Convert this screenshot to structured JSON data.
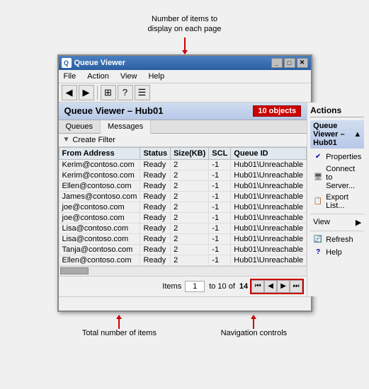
{
  "annotation": {
    "top_text": "Number of items to\ndisplay on each page",
    "bottom_total": "Total number of items",
    "bottom_nav": "Navigation controls"
  },
  "window": {
    "title": "Queue Viewer",
    "icon": "Q"
  },
  "menu": {
    "items": [
      "File",
      "Action",
      "View",
      "Help"
    ]
  },
  "toolbar": {
    "buttons": [
      "◀",
      "▶",
      "⊞",
      "?",
      "☰"
    ]
  },
  "panel_header": {
    "title": "Queue Viewer – Hub01",
    "badge": "10 objects"
  },
  "tabs": {
    "items": [
      "Queues",
      "Messages"
    ],
    "active": "Messages"
  },
  "filter": {
    "label": "Create Filter"
  },
  "table": {
    "columns": [
      "From Address",
      "Status",
      "Size(KB)",
      "SCL",
      "Queue ID"
    ],
    "rows": [
      [
        "Kerim@contoso.com",
        "Ready",
        "2",
        "-1",
        "Hub01\\Unreachable"
      ],
      [
        "Kerim@contoso.com",
        "Ready",
        "2",
        "-1",
        "Hub01\\Unreachable"
      ],
      [
        "Ellen@contoso.com",
        "Ready",
        "2",
        "-1",
        "Hub01\\Unreachable"
      ],
      [
        "James@contoso.com",
        "Ready",
        "2",
        "-1",
        "Hub01\\Unreachable"
      ],
      [
        "joe@contoso.com",
        "Ready",
        "2",
        "-1",
        "Hub01\\Unreachable"
      ],
      [
        "joe@contoso.com",
        "Ready",
        "2",
        "-1",
        "Hub01\\Unreachable"
      ],
      [
        "Lisa@contoso.com",
        "Ready",
        "2",
        "-1",
        "Hub01\\Unreachable"
      ],
      [
        "Lisa@contoso.com",
        "Ready",
        "2",
        "-1",
        "Hub01\\Unreachable"
      ],
      [
        "Tanja@contoso.com",
        "Ready",
        "2",
        "-1",
        "Hub01\\Unreachable"
      ],
      [
        "Ellen@contoso.com",
        "Ready",
        "2",
        "-1",
        "Hub01\\Unreachable"
      ]
    ]
  },
  "pagination": {
    "items_label": "Items",
    "page_value": "1",
    "to_text": "to 10 of",
    "total": "14",
    "nav_buttons": [
      "⏮",
      "◀",
      "▶",
      "⏭"
    ]
  },
  "actions": {
    "title": "Actions",
    "section": "Queue Viewer – Hub01",
    "items": [
      {
        "icon": "✔",
        "label": "Properties",
        "color": "#00a"
      },
      {
        "icon": "🖥",
        "label": "Connect to Server...",
        "color": "#555"
      },
      {
        "icon": "📋",
        "label": "Export List...",
        "color": "#080"
      }
    ],
    "view_label": "View",
    "view_items": [
      {
        "icon": "🔄",
        "label": "Refresh",
        "color": "#0a0"
      },
      {
        "icon": "?",
        "label": "Help",
        "color": "#00a"
      }
    ]
  },
  "status_bar": {
    "text": ""
  }
}
